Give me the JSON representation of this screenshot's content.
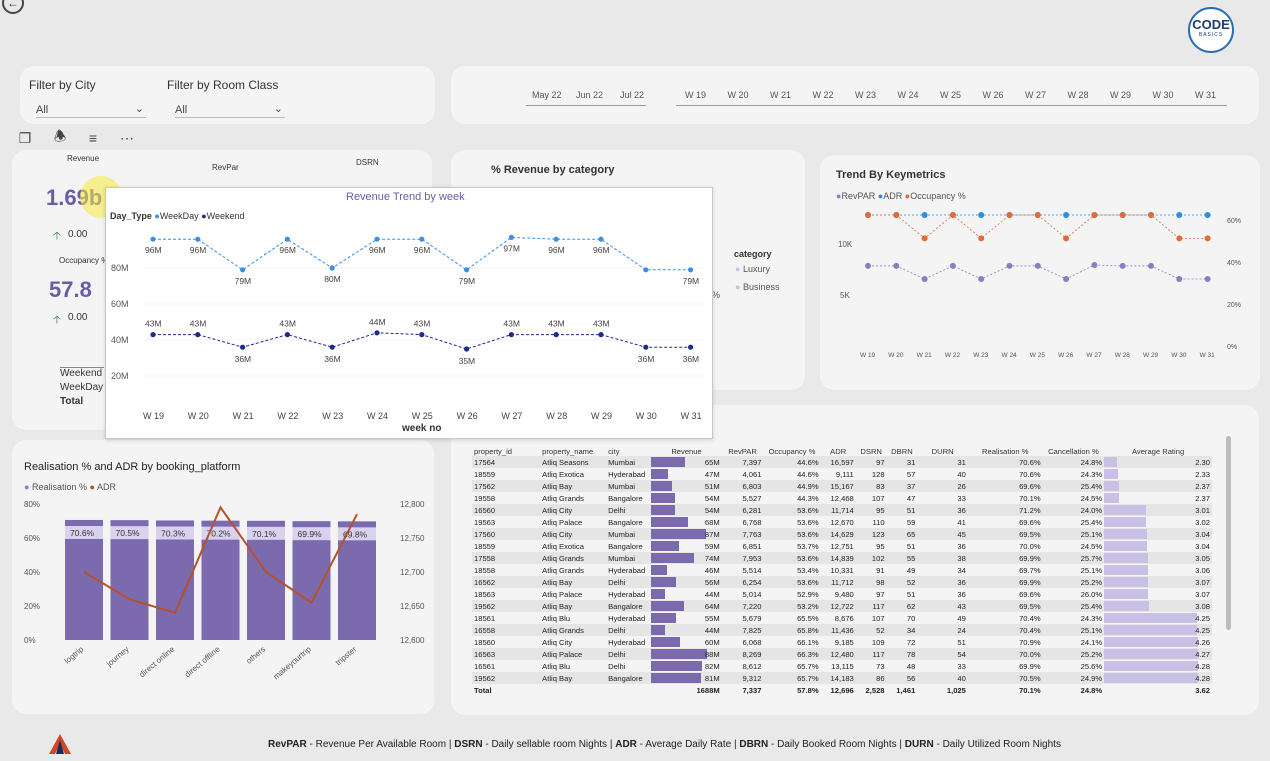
{
  "header": {
    "back_icon": "back-arrow-icon",
    "logo_text": "ODE",
    "logo_sub": "BASICS"
  },
  "filters": {
    "city_label": "Filter by City",
    "city_value": "All",
    "room_label": "Filter by Room Class",
    "room_value": "All"
  },
  "months": [
    "May 22",
    "Jun 22",
    "Jul 22"
  ],
  "weeks": [
    "W 19",
    "W 20",
    "W 21",
    "W 22",
    "W 23",
    "W 24",
    "W 25",
    "W 26",
    "W 27",
    "W 28",
    "W 29",
    "W 30",
    "W 31"
  ],
  "kpi": {
    "revenue_label": "Revenue",
    "revenue_value": "1.69b",
    "revenue_delta": "0.00",
    "revpar_label": "RevPar",
    "dsrn_label": "DSRN",
    "occupancy_label": "Occupancy %",
    "occupancy_value": "57.8",
    "occupancy_delta": "0.00",
    "rows": [
      "Weekend",
      "WeekDay",
      "Total"
    ]
  },
  "category_card": {
    "title": "% Revenue by category",
    "legend_title": "category",
    "legend": [
      "Luxury",
      "Business"
    ]
  },
  "keymetrics": {
    "title": "Trend By Keymetrics",
    "legend": [
      "RevPAR",
      "ADR",
      "Occupancy %"
    ],
    "y_left": [
      "10K",
      "5K"
    ],
    "y_right": [
      "60%",
      "40%",
      "20%",
      "0%"
    ],
    "weeks": [
      "W 19",
      "W 20",
      "W 21",
      "W 22",
      "W 23",
      "W 24",
      "W 25",
      "W 26",
      "W 27",
      "W 28",
      "W 29",
      "W 30",
      "W 31"
    ]
  },
  "revenue_trend": {
    "title": "Revenue Trend by week",
    "legend_title": "Day_Type",
    "legend": [
      "WeekDay",
      "Weekend"
    ],
    "xlabel": "week no",
    "y_ticks": [
      "80M",
      "60M",
      "40M",
      "20M"
    ]
  },
  "realisation": {
    "title": "Realisation % and ADR by booking_platform",
    "legend": [
      "Realisation %",
      "ADR"
    ],
    "y_left": [
      "80%",
      "60%",
      "40%",
      "20%",
      "0%"
    ],
    "y_right": [
      "12,800",
      "12,750",
      "12,700",
      "12,650",
      "12,600"
    ]
  },
  "footer": {
    "text_parts": [
      {
        "b": "RevPAR",
        "t": " - Revenue Per Available Room | "
      },
      {
        "b": "DSRN",
        "t": " - Daily sellable room Nights | "
      },
      {
        "b": "ADR",
        "t": " - Average Daily Rate | "
      },
      {
        "b": "DBRN",
        "t": " - Daily Booked Room Nights | "
      },
      {
        "b": "DURN",
        "t": " - Daily Utilized Room Nights"
      }
    ]
  },
  "table": {
    "headers": [
      "property_id",
      "property_name",
      "city",
      "Revenue",
      "RevPAR",
      "Occupancy %",
      "ADR",
      "DSRN",
      "DBRN",
      "DURN",
      "Realisation %",
      "Cancellation %",
      "Average Rating"
    ],
    "rows": [
      [
        "17564",
        "Atliq Seasons",
        "Mumbai",
        "65M",
        "7,397",
        "44.6%",
        "16,597",
        "97",
        "31",
        "31",
        "70.6%",
        "24.8%",
        "2.30"
      ],
      [
        "18559",
        "Atliq Exotica",
        "Hyderabad",
        "47M",
        "4,061",
        "44.6%",
        "9,111",
        "128",
        "57",
        "40",
        "70.6%",
        "24.3%",
        "2.33"
      ],
      [
        "17562",
        "Atliq Bay",
        "Mumbai",
        "51M",
        "6,803",
        "44.9%",
        "15,167",
        "83",
        "37",
        "26",
        "69.6%",
        "25.4%",
        "2.37"
      ],
      [
        "19558",
        "Atliq Grands",
        "Bangalore",
        "54M",
        "5,527",
        "44.3%",
        "12,468",
        "107",
        "47",
        "33",
        "70.1%",
        "24.5%",
        "2.37"
      ],
      [
        "16560",
        "Atliq City",
        "Delhi",
        "54M",
        "6,281",
        "53.6%",
        "11,714",
        "95",
        "51",
        "36",
        "71.2%",
        "24.0%",
        "3.01"
      ],
      [
        "19563",
        "Atliq Palace",
        "Bangalore",
        "68M",
        "6,768",
        "53.6%",
        "12,670",
        "110",
        "59",
        "41",
        "69.6%",
        "25.4%",
        "3.02"
      ],
      [
        "17560",
        "Atliq City",
        "Mumbai",
        "87M",
        "7,763",
        "53.6%",
        "14,629",
        "123",
        "65",
        "45",
        "69.5%",
        "25.1%",
        "3.04"
      ],
      [
        "18559",
        "Atliq Exotica",
        "Bangalore",
        "59M",
        "6,851",
        "53.7%",
        "12,751",
        "95",
        "51",
        "36",
        "70.0%",
        "24.5%",
        "3.04"
      ],
      [
        "17558",
        "Atliq Grands",
        "Mumbai",
        "74M",
        "7,953",
        "53.6%",
        "14,839",
        "102",
        "55",
        "38",
        "69.9%",
        "25.7%",
        "3.05"
      ],
      [
        "18558",
        "Atliq Grands",
        "Hyderabad",
        "46M",
        "5,514",
        "53.4%",
        "10,331",
        "91",
        "49",
        "34",
        "69.7%",
        "25.1%",
        "3.06"
      ],
      [
        "16562",
        "Atliq Bay",
        "Delhi",
        "56M",
        "6,254",
        "53.6%",
        "11,712",
        "98",
        "52",
        "36",
        "69.9%",
        "25.2%",
        "3.07"
      ],
      [
        "18563",
        "Atliq Palace",
        "Hyderabad",
        "44M",
        "5,014",
        "52.9%",
        "9,480",
        "97",
        "51",
        "36",
        "69.6%",
        "26.0%",
        "3.07"
      ],
      [
        "19562",
        "Atliq Bay",
        "Bangalore",
        "64M",
        "7,220",
        "53.2%",
        "12,722",
        "117",
        "62",
        "43",
        "69.5%",
        "25.4%",
        "3.08"
      ],
      [
        "18561",
        "Atliq Blu",
        "Hyderabad",
        "55M",
        "5,679",
        "65.5%",
        "8,676",
        "107",
        "70",
        "49",
        "70.4%",
        "24.3%",
        "4.25"
      ],
      [
        "16558",
        "Atliq Grands",
        "Delhi",
        "44M",
        "7,825",
        "65.8%",
        "11,436",
        "52",
        "34",
        "24",
        "70.4%",
        "25.1%",
        "4.25"
      ],
      [
        "18560",
        "Atliq City",
        "Hyderabad",
        "60M",
        "6,068",
        "66.1%",
        "9,185",
        "109",
        "72",
        "51",
        "70.9%",
        "24.1%",
        "4.26"
      ],
      [
        "16563",
        "Atliq Palace",
        "Delhi",
        "88M",
        "8,269",
        "66.3%",
        "12,480",
        "117",
        "78",
        "54",
        "70.0%",
        "25.2%",
        "4.27"
      ],
      [
        "16561",
        "Atliq Blu",
        "Delhi",
        "82M",
        "8,612",
        "65.7%",
        "13,115",
        "73",
        "48",
        "33",
        "69.9%",
        "25.6%",
        "4.28"
      ],
      [
        "19562",
        "Atliq Bay",
        "Bangalore",
        "81M",
        "9,312",
        "65.7%",
        "14,183",
        "86",
        "56",
        "40",
        "70.5%",
        "24.9%",
        "4.28"
      ]
    ],
    "total": [
      "Total",
      "",
      "",
      "1688M",
      "7,337",
      "57.8%",
      "12,696",
      "2,528",
      "1,461",
      "1,025",
      "70.1%",
      "24.8%",
      "3.62"
    ]
  },
  "chart_data": [
    {
      "type": "line",
      "title": "Revenue Trend by week",
      "xlabel": "week no",
      "ylabel": "",
      "categories": [
        "W 19",
        "W 20",
        "W 21",
        "W 22",
        "W 23",
        "W 24",
        "W 25",
        "W 26",
        "W 27",
        "W 28",
        "W 29",
        "W 30",
        "W 31"
      ],
      "series": [
        {
          "name": "WeekDay",
          "values": [
            96,
            96,
            79,
            96,
            80,
            96,
            96,
            79,
            97,
            96,
            96,
            79,
            79
          ],
          "labels": [
            "96M",
            "96M",
            "79M",
            "96M",
            "80M",
            "96M",
            "96M",
            "79M",
            "97M",
            "96M",
            "96M",
            "",
            "79M"
          ]
        },
        {
          "name": "Weekend",
          "values": [
            43,
            43,
            36,
            43,
            36,
            44,
            43,
            35,
            43,
            43,
            43,
            36,
            36
          ],
          "labels": [
            "43M",
            "43M",
            "36M",
            "43M",
            "36M",
            "44M",
            "43M",
            "35M",
            "43M",
            "43M",
            "43M",
            "36M",
            "36M"
          ]
        }
      ],
      "ylim": [
        0,
        100
      ]
    },
    {
      "type": "bar",
      "title": "Realisation % and ADR by booking_platform",
      "categories": [
        "logtrip",
        "journey",
        "direct online",
        "direct offline",
        "others",
        "makeyourtrip",
        "tripster"
      ],
      "series": [
        {
          "name": "Realisation %",
          "values": [
            70.6,
            70.5,
            70.3,
            70.2,
            70.1,
            69.9,
            69.8
          ],
          "labels": [
            "70.6%",
            "70.5%",
            "70.3%",
            "70.2%",
            "70.1%",
            "69.9%",
            "69.8%"
          ]
        },
        {
          "name": "ADR",
          "values": [
            12700,
            12660,
            12640,
            12795,
            12700,
            12655,
            12785
          ]
        }
      ],
      "ylim": [
        0,
        80
      ],
      "y2lim": [
        12600,
        12800
      ]
    },
    {
      "type": "line",
      "title": "Trend By Keymetrics",
      "categories": [
        "W 19",
        "W 20",
        "W 21",
        "W 22",
        "W 23",
        "W 24",
        "W 25",
        "W 26",
        "W 27",
        "W 28",
        "W 29",
        "W 30",
        "W 31"
      ],
      "series": [
        {
          "name": "RevPAR",
          "values": [
            7400,
            7400,
            6000,
            7400,
            6000,
            7400,
            7400,
            6000,
            7500,
            7400,
            7400,
            6000,
            6000
          ]
        },
        {
          "name": "ADR",
          "values": [
            12700,
            12700,
            12600,
            12700,
            12600,
            12700,
            12700,
            12600,
            12750,
            12700,
            12700,
            12600,
            12600
          ]
        },
        {
          "name": "Occupancy %",
          "values": [
            62,
            62,
            53,
            62,
            53,
            62,
            62,
            53,
            62,
            62,
            62,
            53,
            53
          ]
        }
      ],
      "colors": [
        "#8e7cc3",
        "#2b8de0",
        "#e06b3a"
      ]
    }
  ]
}
